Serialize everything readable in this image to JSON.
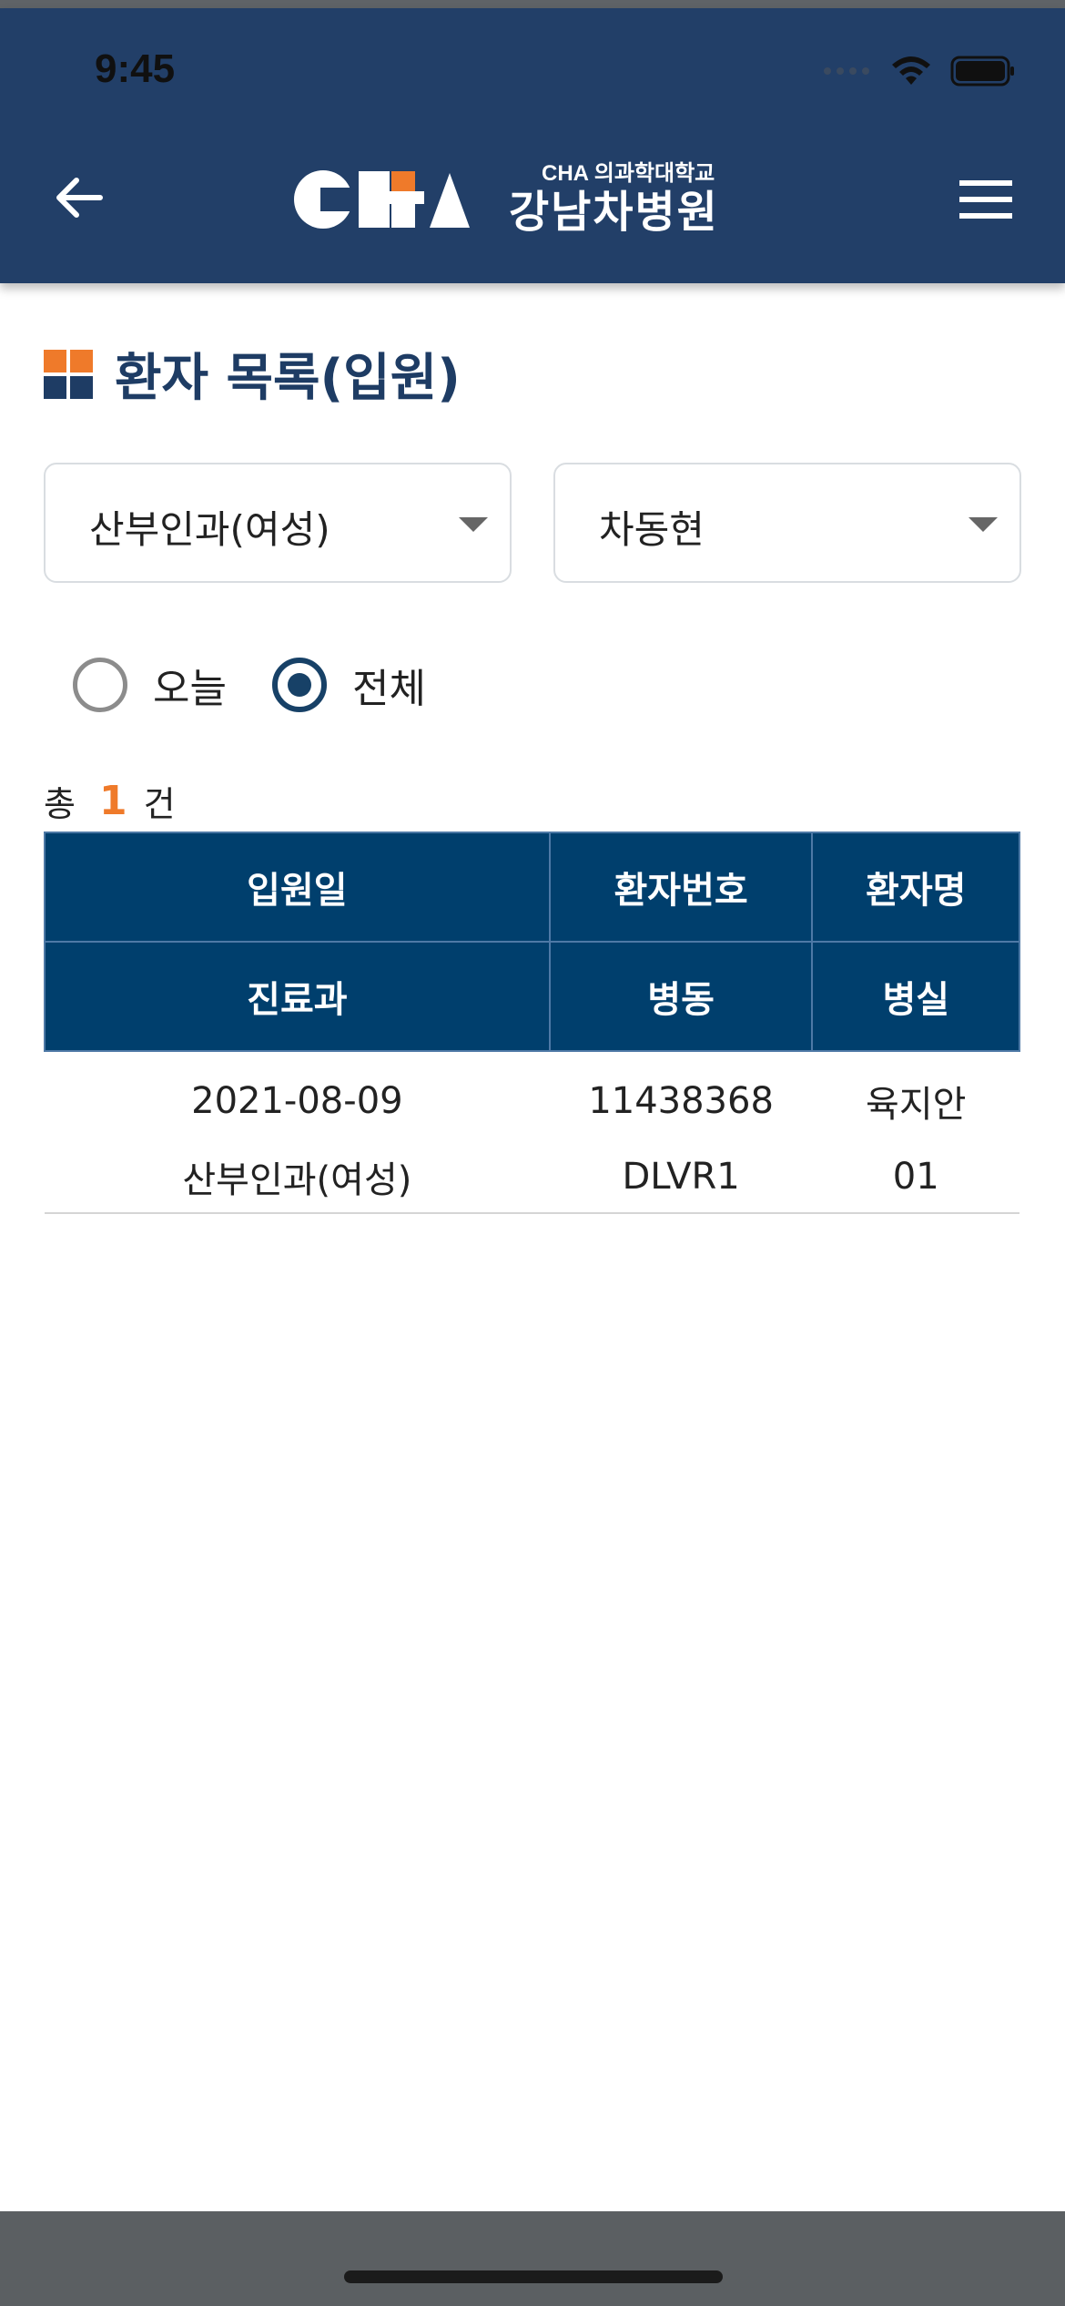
{
  "status_bar": {
    "time": "9:45",
    "icons": [
      "signal-dots-icon",
      "wifi-icon",
      "battery-icon"
    ]
  },
  "header": {
    "logo_sub": "CHA 의과학대학교",
    "logo_main": "강남차병원",
    "back_icon": "arrow-left-icon",
    "menu_icon": "hamburger-menu-icon",
    "bg_color": "#223f68",
    "accent_color": "#ef7a2a"
  },
  "page": {
    "title": "환자 목록(입원)",
    "title_icon": "grid-squares-icon"
  },
  "filters": {
    "department": "산부인과(여성)",
    "doctor": "차동현"
  },
  "radio": {
    "options": [
      {
        "label": "오늘",
        "selected": false
      },
      {
        "label": "전체",
        "selected": true
      }
    ]
  },
  "summary": {
    "prefix": "총",
    "count": "1",
    "suffix": "건"
  },
  "table": {
    "header_row1": [
      "입원일",
      "환자번호",
      "환자명"
    ],
    "header_row2": [
      "진료과",
      "병동",
      "병실"
    ],
    "rows": [
      {
        "line1": [
          "2021-08-09",
          "11438368",
          "육지안"
        ],
        "line2": [
          "산부인과(여성)",
          "DLVR1",
          "01"
        ]
      }
    ],
    "header_color": "#003f6d"
  }
}
